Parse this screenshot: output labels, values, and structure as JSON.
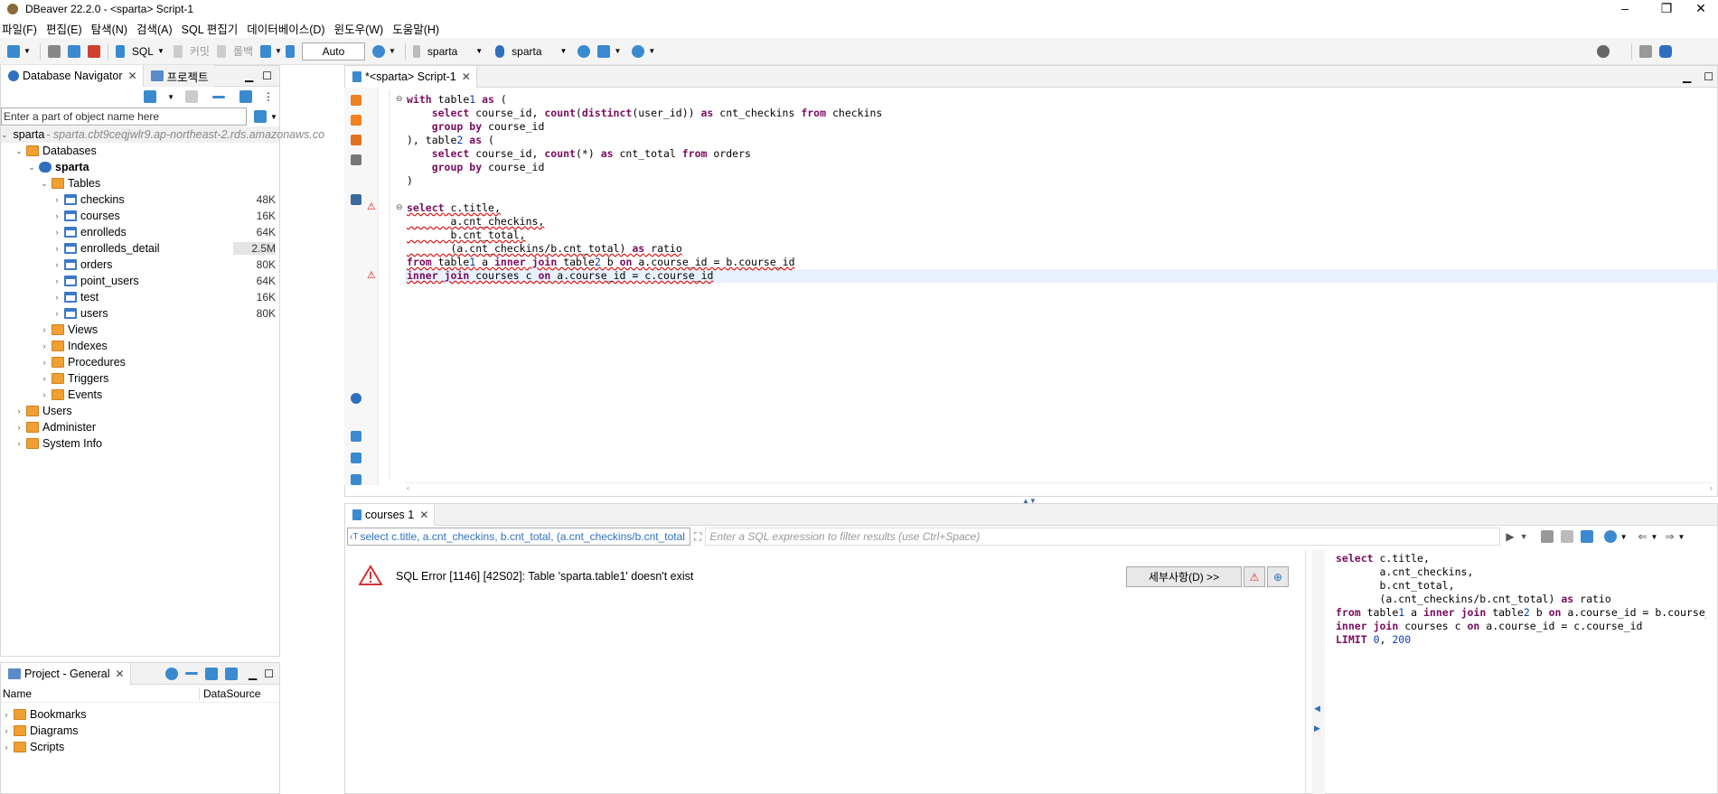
{
  "window": {
    "title": "DBeaver 22.2.0 - <sparta> Script-1"
  },
  "menu": [
    "파일(F)",
    "편집(E)",
    "탐색(N)",
    "검색(A)",
    "SQL 편집기",
    "데이터베이스(D)",
    "윈도우(W)",
    "도움말(H)"
  ],
  "toolbar": {
    "sql_label": "SQL",
    "commit_label": "커밋",
    "rollback_label": "롤백",
    "mode_value": "Auto",
    "datasource": "sparta",
    "schema": "sparta"
  },
  "navigator": {
    "tab_db": "Database Navigator",
    "tab_project": "프로젝트",
    "filter_placeholder": "Enter a part of object name here",
    "connection": {
      "name": "sparta",
      "host": " - sparta.cbt9ceqjwlr9.ap-northeast-2.rds.amazonaws.co"
    },
    "databases_label": "Databases",
    "db_name": "sparta",
    "tables_label": "Tables",
    "tables": [
      {
        "name": "checkins",
        "size": "48K"
      },
      {
        "name": "courses",
        "size": "16K"
      },
      {
        "name": "enrolleds",
        "size": "64K"
      },
      {
        "name": "enrolleds_detail",
        "size": "2.5M"
      },
      {
        "name": "orders",
        "size": "80K"
      },
      {
        "name": "point_users",
        "size": "64K"
      },
      {
        "name": "test",
        "size": "16K"
      },
      {
        "name": "users",
        "size": "80K"
      }
    ],
    "db_folders": [
      "Views",
      "Indexes",
      "Procedures",
      "Triggers",
      "Events"
    ],
    "conn_folders": [
      "Users",
      "Administer",
      "System Info"
    ]
  },
  "project": {
    "tab": "Project - General",
    "col_name": "Name",
    "col_datasource": "DataSource",
    "items": [
      "Bookmarks",
      "Diagrams",
      "Scripts"
    ]
  },
  "editor": {
    "tab": "*<sparta> Script-1",
    "lines": [
      [
        "with table1 as ("
      ],
      [
        "    select course_id, count(distinct(user_id)) as cnt_checkins from checkins"
      ],
      [
        "    group by course_id"
      ],
      [
        "), table2 as ("
      ],
      [
        "    select course_id, count(*) as cnt_total from orders"
      ],
      [
        "    group by course_id"
      ],
      [
        ")"
      ],
      [
        ""
      ],
      [
        "select c.title,"
      ],
      [
        "       a.cnt_checkins,"
      ],
      [
        "       b.cnt_total,"
      ],
      [
        "       (a.cnt_checkins/b.cnt_total) as ratio"
      ],
      [
        "from table1 a inner join table2 b on a.course_id = b.course_id"
      ],
      [
        "inner join courses c on a.course_id = c.course_id"
      ]
    ]
  },
  "results": {
    "tab": "courses 1",
    "query_preview": "select c.title, a.cnt_checkins, b.cnt_total, (a.cnt_checkins/b.cnt_total",
    "filter_placeholder": "Enter a SQL expression to filter results (use Ctrl+Space)",
    "error_message": "SQL Error [1146] [42S02]: Table 'sparta.table1' doesn't exist",
    "details_button": "세부사항(D) >>",
    "side_sql": [
      "select c.title,",
      "       a.cnt_checkins,",
      "       b.cnt_total,",
      "       (a.cnt_checkins/b.cnt_total) as ratio",
      "from table1 a inner join table2 b on a.course_id = b.course_",
      "inner join courses c on a.course_id = c.course_id",
      "LIMIT 0, 200"
    ]
  },
  "colors": {
    "accent": "#2f6fbf",
    "error": "#e01010",
    "keyword": "#7a0c5f"
  }
}
